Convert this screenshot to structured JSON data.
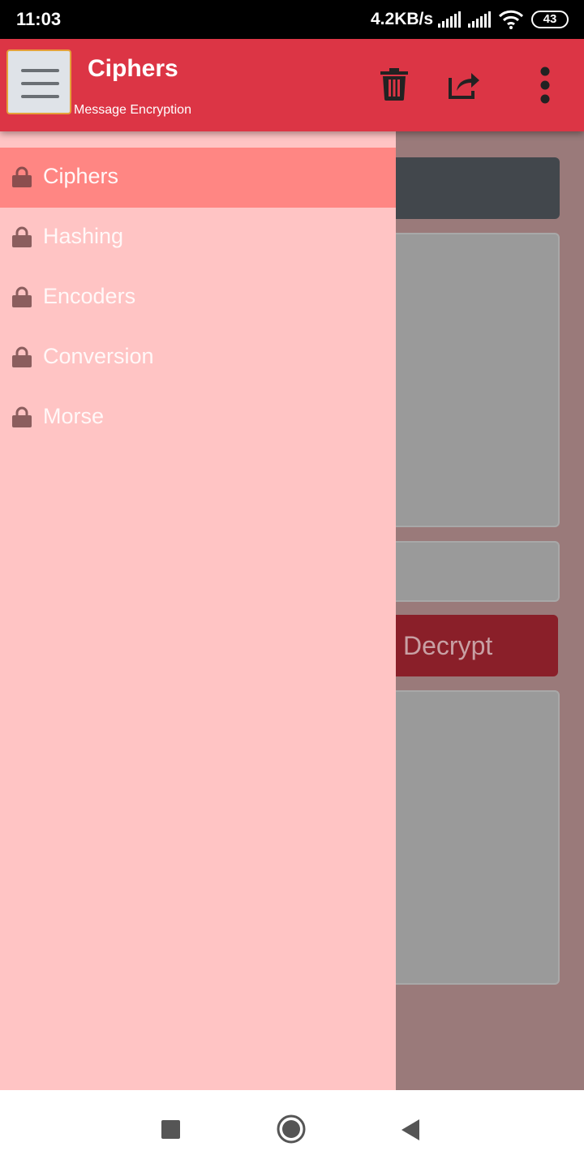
{
  "status_bar": {
    "time": "11:03",
    "network_speed": "4.2KB/s",
    "battery_level": "43"
  },
  "app_bar": {
    "title": "Ciphers",
    "subtitle": "Message Encryption",
    "actions": [
      "trash-icon",
      "share-icon",
      "more-vertical-icon"
    ],
    "color": "#dc3545"
  },
  "drawer": {
    "items": [
      {
        "label": "Ciphers",
        "icon": "lock-icon",
        "active": true
      },
      {
        "label": "Hashing",
        "icon": "lock-icon",
        "active": false
      },
      {
        "label": "Encoders",
        "icon": "lock-icon",
        "active": false
      },
      {
        "label": "Conversion",
        "icon": "lock-icon",
        "active": false
      },
      {
        "label": "Morse",
        "icon": "lock-icon",
        "active": false
      }
    ],
    "background": "#ffc4c4",
    "active_color": "#ff8683"
  },
  "main": {
    "decrypt_label": "Decrypt"
  },
  "nav_bar": {
    "buttons": [
      "recent-apps-icon",
      "home-icon",
      "back-icon"
    ]
  }
}
